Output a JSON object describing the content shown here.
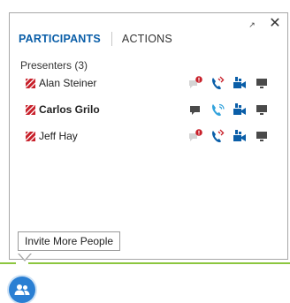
{
  "tabs": [
    {
      "label": "PARTICIPANTS",
      "active": true
    },
    {
      "label": "ACTIONS",
      "active": false
    }
  ],
  "window_controls": {
    "pin_icon": "pin-icon",
    "close_icon": "close-icon"
  },
  "group": {
    "header": "Presenters (3)"
  },
  "participants": [
    {
      "name": "Alan Steiner",
      "bold": false,
      "im_alert": true,
      "audio": "muted-alert",
      "video": "off",
      "sharing": "off"
    },
    {
      "name": "Carlos Grilo",
      "bold": true,
      "im_alert": false,
      "audio": "connecting",
      "video": "off",
      "sharing": "off"
    },
    {
      "name": "Jeff Hay",
      "bold": false,
      "im_alert": true,
      "audio": "muted-alert",
      "video": "off",
      "sharing": "off"
    }
  ],
  "invite_button": {
    "label": "Invite More People"
  },
  "people_button_icon": "people-icon",
  "colors": {
    "accent_blue": "#0a5ea8",
    "presenter_red": "#c8202a",
    "alert_red": "#c8202a",
    "status_green": "#8cc63f",
    "people_button": "#2a7fd3"
  }
}
